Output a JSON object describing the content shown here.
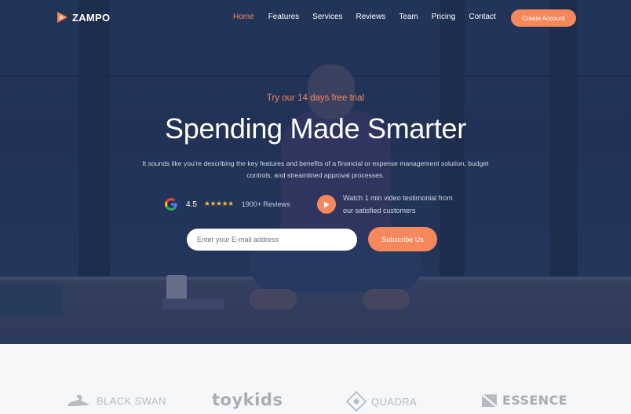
{
  "brand": {
    "name": "ZAMPO",
    "accent": "#f6885c"
  },
  "nav": {
    "items": [
      {
        "label": "Home",
        "active": true
      },
      {
        "label": "Features"
      },
      {
        "label": "Services"
      },
      {
        "label": "Reviews"
      },
      {
        "label": "Team"
      },
      {
        "label": "Pricing"
      },
      {
        "label": "Contact"
      }
    ],
    "cta_label": "Create Account"
  },
  "hero": {
    "eyebrow": "Try our 14 days free trial",
    "title": "Spending Made Smarter",
    "description": "It sounds like you're describing the key features and benefits of a financial or expense management solution, budget controls, and streamlined approval processes.",
    "rating": {
      "value": "4.5",
      "stars": "★★★★★",
      "reviews": "1900+ Reviews",
      "icon": "google-icon"
    },
    "video": {
      "line1": "Watch 1 min video testimonial from",
      "line2": "our satisfied customers",
      "icon": "play-icon"
    },
    "email_placeholder": "Enter your E-mail address",
    "subscribe_label": "Subscribe Us"
  },
  "partners": [
    {
      "name": "BLACK SWAN",
      "icon": "swan-icon"
    },
    {
      "name": "toykids"
    },
    {
      "name": "QUADRA",
      "icon": "diamond-icon"
    },
    {
      "name": "ESSENCE",
      "icon": "essence-icon"
    }
  ]
}
